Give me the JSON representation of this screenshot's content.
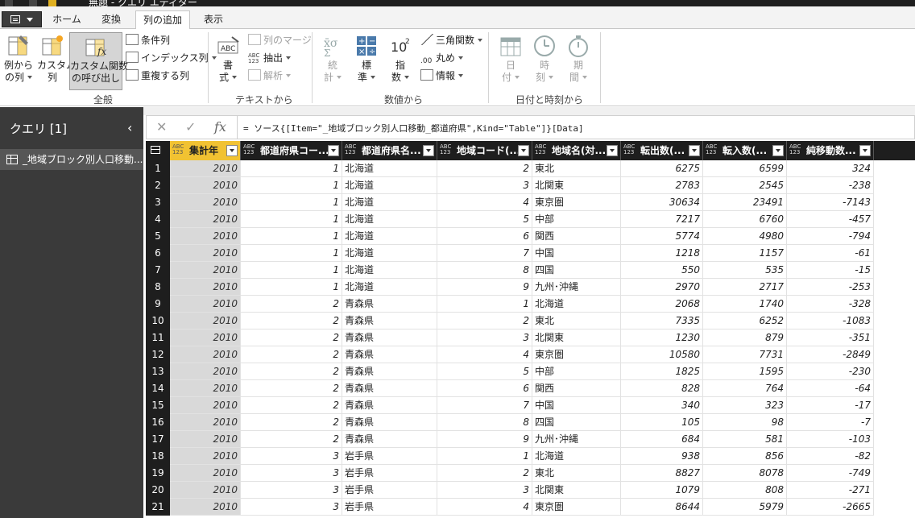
{
  "window": {
    "title": "無題 - クエリ エディター"
  },
  "tabs": [
    "ホーム",
    "変換",
    "列の追加",
    "表示"
  ],
  "active_tab": "列の追加",
  "ribbon": {
    "general": {
      "group_label": "全般",
      "example_col": "例から\nの列",
      "custom_col": "カスタム\n列",
      "invoke_func": "カスタム関数\nの呼び出し",
      "conditional": "条件列",
      "index": "インデックス列",
      "duplicate": "重複する列"
    },
    "text": {
      "group_label": "テキストから",
      "format": "書\n式",
      "merge": "列のマージ",
      "extract": "抽出",
      "parse": "解析"
    },
    "number": {
      "group_label": "数値から",
      "stats": "統\n計",
      "standard": "標\n準",
      "scientific": "指\n数",
      "trig": "三角関数",
      "round": "丸め",
      "info": "情報"
    },
    "datetime": {
      "group_label": "日付と時刻から",
      "date": "日\n付",
      "time": "時\n刻",
      "duration": "期\n間"
    }
  },
  "queries": {
    "title": "クエリ [1]",
    "items": [
      "_地域ブロック別人口移動..."
    ]
  },
  "formula": "= ソース{[Item=\"_地域ブロック別人口移動_都道府県\",Kind=\"Table\"]}[Data]",
  "columns": [
    {
      "name": "集計年",
      "type": "ABC\n123"
    },
    {
      "name": "都道府県コー...",
      "type": "ABC\n123"
    },
    {
      "name": "都道府県名...",
      "type": "ABC\n123"
    },
    {
      "name": "地域コード(...",
      "type": "ABC\n123"
    },
    {
      "name": "地域名(対...",
      "type": "ABC\n123"
    },
    {
      "name": "転出数(...",
      "type": "ABC\n123"
    },
    {
      "name": "転入数(...",
      "type": "ABC\n123"
    },
    {
      "name": "純移動数...",
      "type": "ABC\n123"
    }
  ],
  "rows": [
    [
      "2010",
      "1",
      "北海道",
      "2",
      "東北",
      "6275",
      "6599",
      "324"
    ],
    [
      "2010",
      "1",
      "北海道",
      "3",
      "北関東",
      "2783",
      "2545",
      "-238"
    ],
    [
      "2010",
      "1",
      "北海道",
      "4",
      "東京圏",
      "30634",
      "23491",
      "-7143"
    ],
    [
      "2010",
      "1",
      "北海道",
      "5",
      "中部",
      "7217",
      "6760",
      "-457"
    ],
    [
      "2010",
      "1",
      "北海道",
      "6",
      "関西",
      "5774",
      "4980",
      "-794"
    ],
    [
      "2010",
      "1",
      "北海道",
      "7",
      "中国",
      "1218",
      "1157",
      "-61"
    ],
    [
      "2010",
      "1",
      "北海道",
      "8",
      "四国",
      "550",
      "535",
      "-15"
    ],
    [
      "2010",
      "1",
      "北海道",
      "9",
      "九州･沖縄",
      "2970",
      "2717",
      "-253"
    ],
    [
      "2010",
      "2",
      "青森県",
      "1",
      "北海道",
      "2068",
      "1740",
      "-328"
    ],
    [
      "2010",
      "2",
      "青森県",
      "2",
      "東北",
      "7335",
      "6252",
      "-1083"
    ],
    [
      "2010",
      "2",
      "青森県",
      "3",
      "北関東",
      "1230",
      "879",
      "-351"
    ],
    [
      "2010",
      "2",
      "青森県",
      "4",
      "東京圏",
      "10580",
      "7731",
      "-2849"
    ],
    [
      "2010",
      "2",
      "青森県",
      "5",
      "中部",
      "1825",
      "1595",
      "-230"
    ],
    [
      "2010",
      "2",
      "青森県",
      "6",
      "関西",
      "828",
      "764",
      "-64"
    ],
    [
      "2010",
      "2",
      "青森県",
      "7",
      "中国",
      "340",
      "323",
      "-17"
    ],
    [
      "2010",
      "2",
      "青森県",
      "8",
      "四国",
      "105",
      "98",
      "-7"
    ],
    [
      "2010",
      "2",
      "青森県",
      "9",
      "九州･沖縄",
      "684",
      "581",
      "-103"
    ],
    [
      "2010",
      "3",
      "岩手県",
      "1",
      "北海道",
      "938",
      "856",
      "-82"
    ],
    [
      "2010",
      "3",
      "岩手県",
      "2",
      "東北",
      "8827",
      "8078",
      "-749"
    ],
    [
      "2010",
      "3",
      "岩手県",
      "3",
      "北関東",
      "1079",
      "808",
      "-271"
    ],
    [
      "2010",
      "3",
      "岩手県",
      "4",
      "東京圏",
      "8644",
      "5979",
      "-2665"
    ]
  ],
  "colors": {
    "selected_header": "#f1c232",
    "selected_col": "#d9d9d9",
    "dark": "#1e1e1e"
  }
}
